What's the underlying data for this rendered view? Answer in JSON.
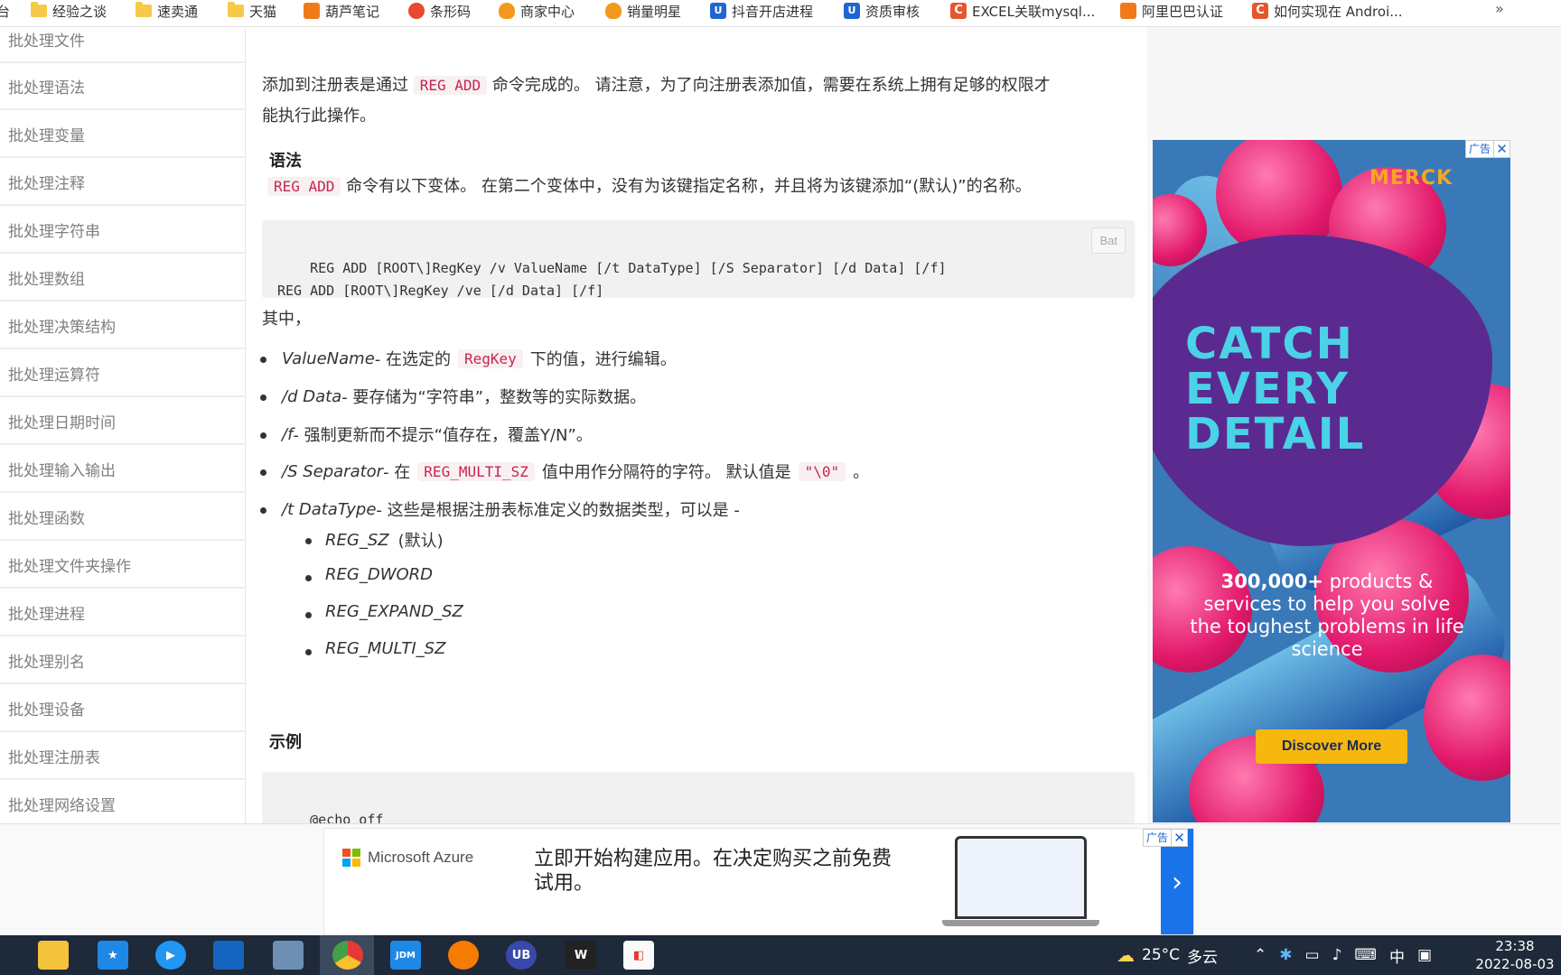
{
  "bookmarks": {
    "items": [
      {
        "label": "台",
        "icon": "folder-icon"
      },
      {
        "label": "经验之谈",
        "icon": "folder-icon"
      },
      {
        "label": "速卖通",
        "icon": "folder-icon"
      },
      {
        "label": "天猫",
        "icon": "folder-icon"
      },
      {
        "label": "葫芦笔记",
        "icon": "gourd-icon"
      },
      {
        "label": "条形码",
        "icon": "barcode-site-icon"
      },
      {
        "label": "商家中心",
        "icon": "merchant-icon"
      },
      {
        "label": "销量明星",
        "icon": "sales-star-icon"
      },
      {
        "label": "抖音开店进程",
        "icon": "blue-u-icon"
      },
      {
        "label": "资质审核",
        "icon": "blue-u-icon"
      },
      {
        "label": "EXCEL关联mysql...",
        "icon": "csdn-icon"
      },
      {
        "label": "阿里巴巴认证",
        "icon": "taobao-icon"
      },
      {
        "label": "如何实现在 Androi...",
        "icon": "csdn-icon"
      }
    ],
    "more": "»"
  },
  "sidebar": {
    "items": [
      "批处理文件",
      "批处理语法",
      "批处理变量",
      "批处理注释",
      "批处理字符串",
      "批处理数组",
      "批处理决策结构",
      "批处理运算符",
      "批处理日期时间",
      "批处理输入输出",
      "批处理函数",
      "批处理文件夹操作",
      "批处理进程",
      "批处理别名",
      "批处理设备",
      "批处理注册表",
      "批处理网络设置"
    ]
  },
  "content": {
    "intro_a": "添加到注册表是通过",
    "intro_code": "REG ADD",
    "intro_b": "命令完成的。 请注意，为了向注册表添加值，需要在系统上拥有足够的权限才",
    "intro_c": "能执行此操作。",
    "syntax_heading": "语法",
    "syntax_code": "REG ADD",
    "syntax_text": "命令有以下变体。 在第二个变体中，没有为该键指定名称，并且将为该键添加“(默认)”的名称。",
    "code1": "REG ADD [ROOT\\]RegKey /v ValueName [/t DataType] [/S Separator] [/d Data] [/f]\nREG ADD [ROOT\\]RegKey /ve [/d Data] [/f]",
    "code_lang": "Bat",
    "where": "其中，",
    "params": [
      {
        "term": "ValueName",
        "text_a": " - 在选定的",
        "code": "RegKey",
        "text_b": "下的值，进行编辑。"
      },
      {
        "term": "/d Data",
        "text_a": " - 要存储为“字符串”，整数等的实际数据。",
        "code": "",
        "text_b": ""
      },
      {
        "term": "/f",
        "text_a": " - 强制更新而不提示“值存在，覆盖Y/N”。",
        "code": "",
        "text_b": ""
      },
      {
        "term": "/S Separator",
        "text_a": " - 在",
        "code": "REG_MULTI_SZ",
        "text_b": "值中用作分隔符的字符。 默认值是",
        "code2": "\"\\0\"",
        "text_c": "。"
      },
      {
        "term": "/t DataType",
        "text_a": " - 这些是根据注册表标准定义的数据类型，可以是 -",
        "code": "",
        "text_b": ""
      }
    ],
    "types": [
      {
        "term": "REG_SZ",
        "note": "(默认)"
      },
      {
        "term": "REG_DWORD",
        "note": ""
      },
      {
        "term": "REG_EXPAND_SZ",
        "note": ""
      },
      {
        "term": "REG_MULTI_SZ",
        "note": ""
      }
    ],
    "example_heading": "示例",
    "code2": "@echo off\nREG ADD HKEY_CURRENT_USER\\Console /v Test /d \"Test Data\""
  },
  "right_ad": {
    "flag": "广告",
    "close": "✕",
    "logo": "MERCK",
    "headline_1": "CATCH",
    "headline_2": "EVERY",
    "headline_3": "DETAIL",
    "body_bold": "300,000+",
    "body": " products & services to help you solve the toughest problems in life science",
    "cta": "Discover More"
  },
  "bottom_ad": {
    "brand": "Microsoft Azure",
    "text": "立即开始构建应用。在决定购买之前免费试用。",
    "flag": "广告",
    "close": "✕",
    "arrow": "›"
  },
  "taskbar": {
    "weather": "25°C",
    "weather_desc": "多云",
    "ime": "中",
    "time": "23:38",
    "date": "2022-08-03"
  }
}
